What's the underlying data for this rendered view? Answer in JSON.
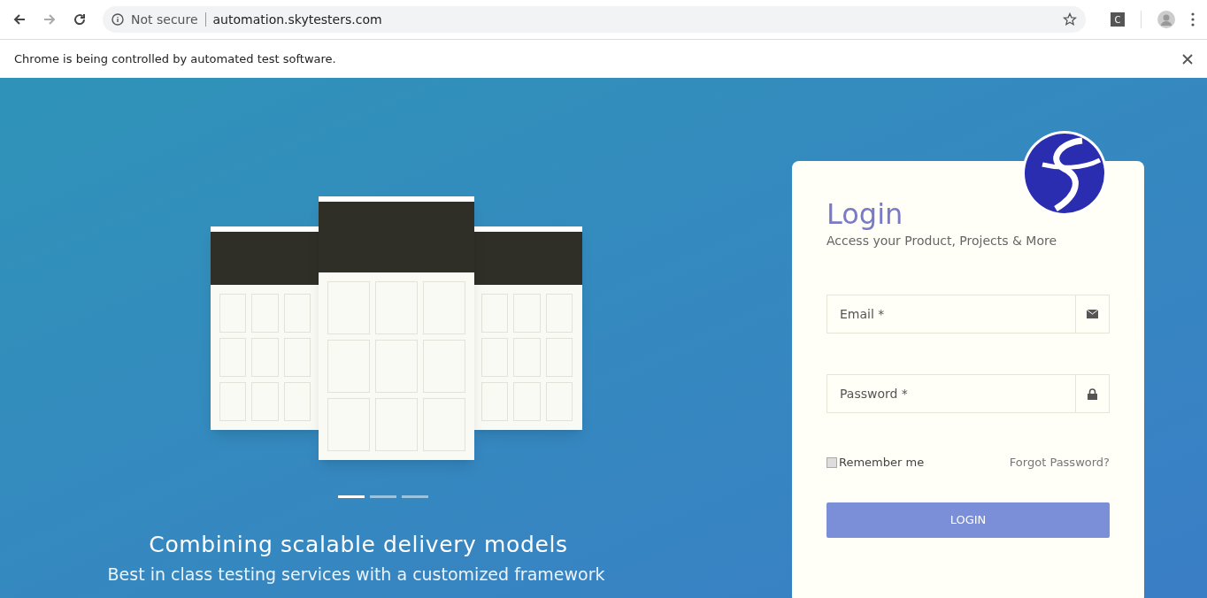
{
  "browser": {
    "security": "Not secure",
    "url": "automation.skytesters.com",
    "profile_initial": "C"
  },
  "infobar": {
    "message": "Chrome is being controlled by automated test software."
  },
  "carousel": {
    "indicators": [
      {
        "selected": true
      },
      {
        "selected": false
      },
      {
        "selected": false
      }
    ],
    "heading": "Combining scalable delivery models",
    "subheading": "Best in class testing services with a customized framework"
  },
  "login": {
    "title": "Login",
    "subtitle": "Access your Product, Projects & More",
    "fields": [
      {
        "kind": "email",
        "placeholder": "Email *"
      },
      {
        "kind": "password",
        "placeholder": "Password *"
      }
    ],
    "remember": {
      "label": "Remember me",
      "checked": false
    },
    "forgot": "Forgot Password?",
    "button": "LOGIN"
  }
}
